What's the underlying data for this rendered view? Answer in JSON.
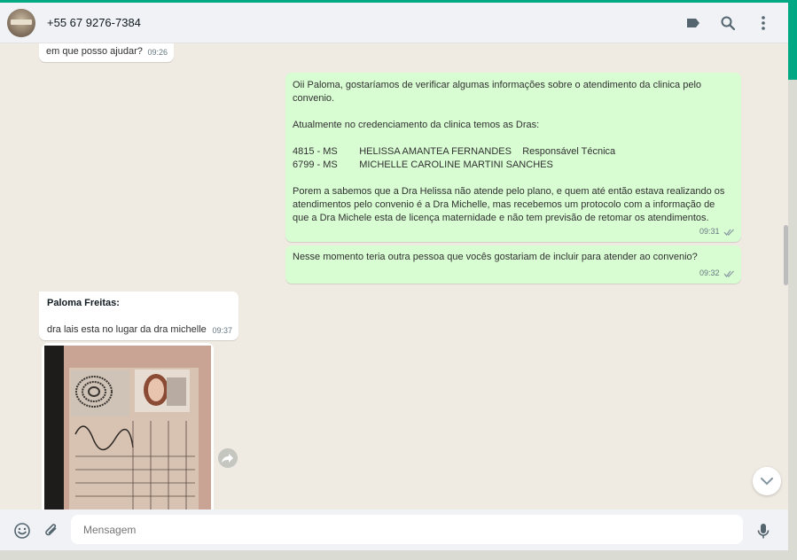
{
  "header": {
    "contact_name": "+55 67 9276-7384",
    "icons": [
      "label-icon",
      "search-icon",
      "menu-icon"
    ]
  },
  "messages": [
    {
      "type": "in",
      "text": "em que posso ajudar?",
      "time": "09:26"
    },
    {
      "type": "out",
      "text": "Oii Paloma, gostaríamos de verificar algumas informações sobre o atendimento da clinica pelo\nconvenio.\n\nAtualmente no credenciamento da clinica temos as Dras:\n\n4815 - MS        HELISSA AMANTEA FERNANDES    Responsável Técnica\n6799 - MS        MICHELLE CAROLINE MARTINI SANCHES\n\nPorem a sabemos que a Dra Helissa não atende pelo plano, e quem até então estava realizando os\natendimentos pelo convenio é a Dra Michelle, mas recebemos um protocolo com a informação de\nque a Dra Michele esta de licença maternidade e não tem previsão de retomar os atendimentos.",
      "time": "09:31"
    },
    {
      "type": "out",
      "text": "Nesse momento teria outra pessoa que vocês gostariam de incluir para atender ao convenio?",
      "time": "09:32"
    },
    {
      "type": "in",
      "sender": "Paloma Freitas:",
      "text": "dra lais esta no lugar da dra michelle",
      "time": "09:37"
    }
  ],
  "footer": {
    "placeholder": "Mensagem"
  },
  "colors": {
    "accent": "#00a884",
    "incoming": "#ffffff",
    "outgoing": "#d9fdd3",
    "chat_bg": "#efeae2"
  }
}
